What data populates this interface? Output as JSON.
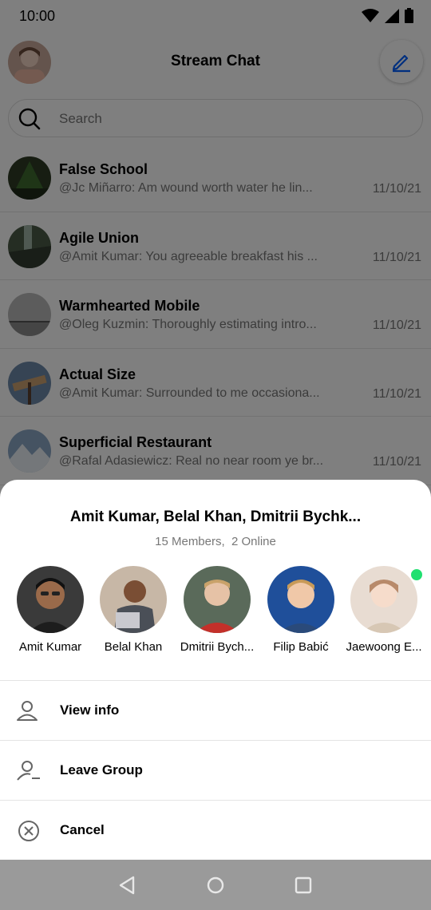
{
  "status_bar": {
    "time": "10:00"
  },
  "header": {
    "title": "Stream Chat"
  },
  "search": {
    "placeholder": "Search"
  },
  "channels": [
    {
      "name": "False School",
      "preview": "@Jc Miñarro: Am wound worth water he lin...",
      "date": "11/10/21"
    },
    {
      "name": "Agile Union",
      "preview": "@Amit Kumar: You agreeable breakfast his ...",
      "date": "11/10/21"
    },
    {
      "name": "Warmhearted Mobile",
      "preview": "@Oleg Kuzmin: Thoroughly estimating intro...",
      "date": "11/10/21"
    },
    {
      "name": "Actual Size",
      "preview": "@Amit Kumar: Surrounded to me occasiona...",
      "date": "11/10/21"
    },
    {
      "name": "Superficial Restaurant",
      "preview": "@Rafal Adasiewicz: Real no near room ye br...",
      "date": "11/10/21"
    }
  ],
  "sheet": {
    "title": "Amit Kumar, Belal Khan, Dmitrii Bychk...",
    "subtitle": "15 Members,  2 Online",
    "members": [
      {
        "name": "Amit Kumar",
        "online": false
      },
      {
        "name": "Belal Khan",
        "online": false
      },
      {
        "name": "Dmitrii Bych...",
        "online": false
      },
      {
        "name": "Filip Babić",
        "online": false
      },
      {
        "name": "Jaewoong E...",
        "online": true
      }
    ],
    "actions": [
      {
        "label": "View info",
        "icon": "person-icon"
      },
      {
        "label": "Leave Group",
        "icon": "person-remove-icon"
      },
      {
        "label": "Cancel",
        "icon": "close-circle-icon"
      }
    ]
  },
  "colors": {
    "accent": "#005fff",
    "online": "#20e070",
    "scrim": "rgba(0,0,0,0.5)"
  }
}
